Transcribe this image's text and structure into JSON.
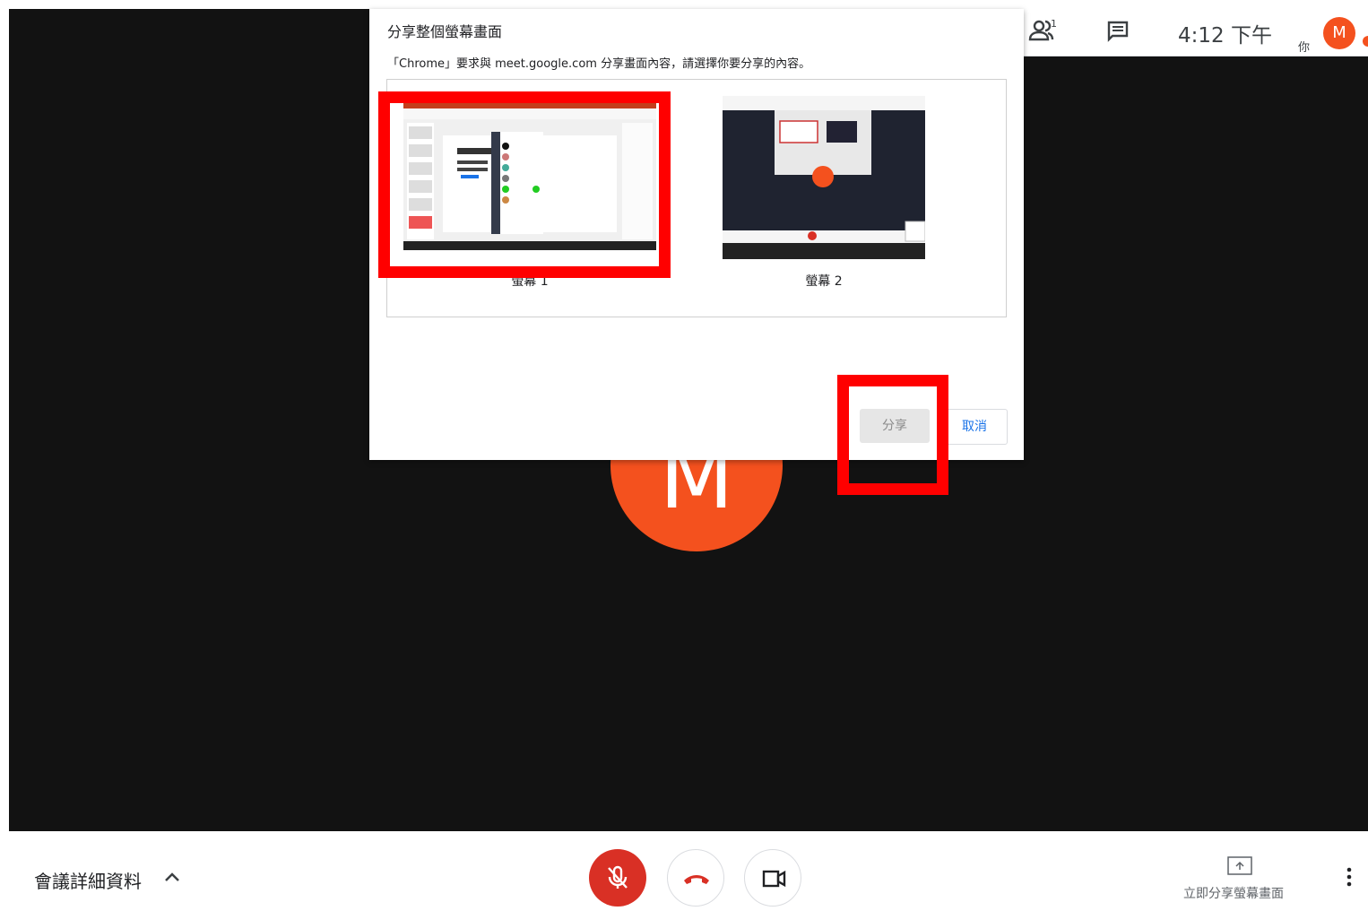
{
  "topbar": {
    "participants_count": "1",
    "time": "4:12 下午",
    "you_label": "你",
    "avatar_initial": "M"
  },
  "main": {
    "avatar_initial": "M"
  },
  "dialog": {
    "title": "分享整個螢幕畫面",
    "subtitle": "「Chrome」要求與 meet.google.com 分享畫面內容，請選擇你要分享的內容。",
    "screens": [
      {
        "label": "螢幕 1",
        "selected": true
      },
      {
        "label": "螢幕 2",
        "selected": false
      }
    ],
    "share_button": "分享",
    "cancel_button": "取消"
  },
  "bottombar": {
    "details_label": "會議詳細資料",
    "present_label": "立即分享螢幕畫面"
  },
  "colors": {
    "accent_orange": "#f4511e",
    "mic_red": "#d93025",
    "highlight": "#ff0000",
    "link_blue": "#1a73e8"
  }
}
